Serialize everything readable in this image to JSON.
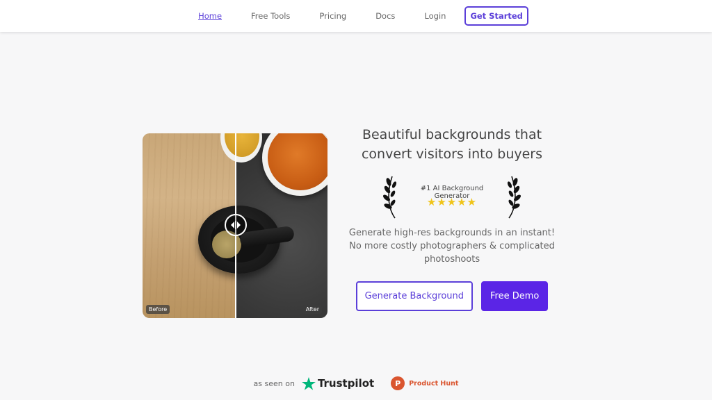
{
  "nav": {
    "items": [
      {
        "label": "Home",
        "active": true
      },
      {
        "label": "Free Tools",
        "active": false
      },
      {
        "label": "Pricing",
        "active": false
      },
      {
        "label": "Docs",
        "active": false
      },
      {
        "label": "Login",
        "active": false
      }
    ],
    "cta_label": "Get Started"
  },
  "compare": {
    "before_label": "Before",
    "after_label": "After"
  },
  "hero": {
    "headline_line1": "Beautiful backgrounds that",
    "headline_line2": "convert visitors into buyers",
    "award_title": "#1 AI Background Generator",
    "stars": "★★★★★",
    "desc_line1": "Generate high-res backgrounds in an instant!",
    "desc_line2": "No more costly photographers & complicated",
    "desc_line3": "photoshoots",
    "primary_button": "Generate Background",
    "secondary_button": "Free Demo"
  },
  "proof": {
    "label": "as seen on",
    "trustpilot": "Trustpilot",
    "producthunt": "Product Hunt",
    "producthunt_letter": "P"
  },
  "colors": {
    "accent": "#5b3fd9",
    "accent_solid": "#5b25e6",
    "star": "#f0c419",
    "trustpilot_green": "#00b67a",
    "producthunt_orange": "#da552f"
  }
}
